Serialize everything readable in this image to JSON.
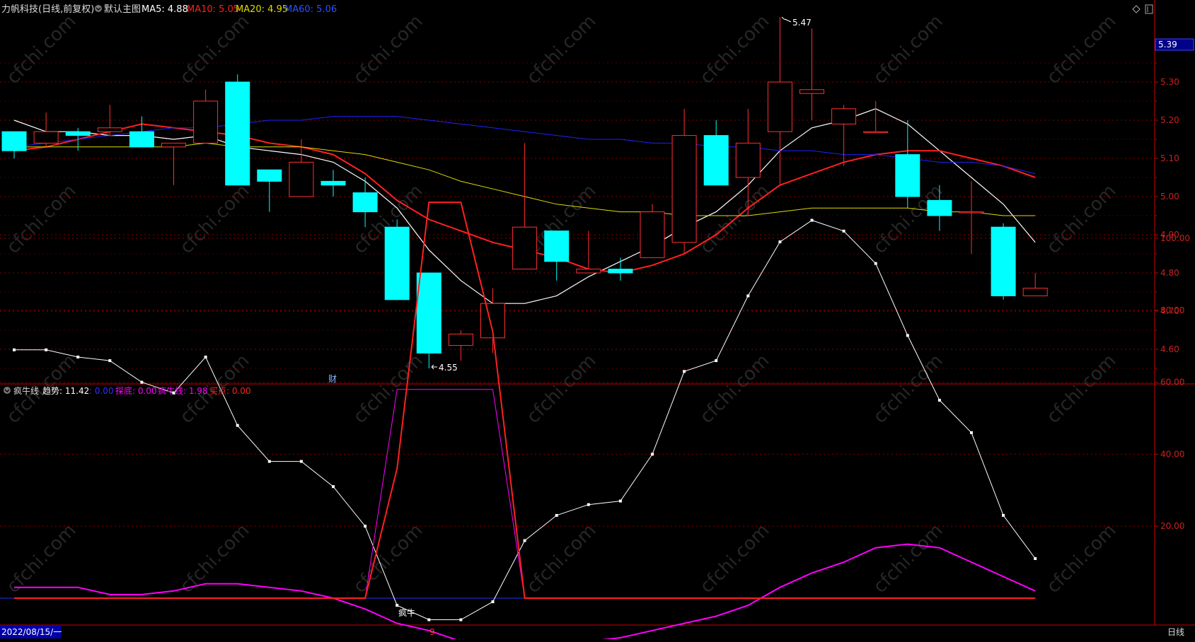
{
  "main_header": {
    "title": "力帆科技(日线,前复权)",
    "template": "默认主图",
    "ma5": "MA5: 4.88",
    "ma10": "MA10: 5.05",
    "ma20": "MA20: 4.95",
    "ma60": "MA60: 5.06"
  },
  "sub_header": {
    "name": "疯牛线",
    "trend": "趋势: 11.42",
    "blue": ": 0.00",
    "bottom": "探底: 0.00",
    "bull": "疯牛线: 1.98",
    "buy": "买点: 0.00"
  },
  "footer": {
    "date": "2022/08/15/一",
    "marker": "9",
    "period": "日线"
  },
  "labels": {
    "high": "5.47",
    "low": "4.55",
    "fin": "财",
    "bull_signal": "疯牛",
    "price_tag": "5.39"
  },
  "colors": {
    "up": "#ff3030",
    "down": "#00ffff",
    "ma5": "#ffffff",
    "ma10": "#ff2020",
    "ma20": "#dddd00",
    "ma60": "#2020ff",
    "magenta": "#ff00ff",
    "grid": "#8b0000",
    "axis": "#c80000"
  },
  "chart_data": [
    {
      "type": "candlestick",
      "title": "力帆科技(日线,前复权)",
      "ylim": [
        4.5,
        5.5
      ],
      "yticks": [
        "5.30",
        "5.20",
        "5.10",
        "5.00",
        "4.90",
        "4.80",
        "4.70",
        "4.60"
      ],
      "ohlc": [
        [
          5.17,
          5.17,
          5.1,
          5.12
        ],
        [
          5.14,
          5.22,
          5.13,
          5.17
        ],
        [
          5.17,
          5.18,
          5.12,
          5.16
        ],
        [
          5.17,
          5.24,
          5.16,
          5.18
        ],
        [
          5.17,
          5.21,
          5.13,
          5.13
        ],
        [
          5.13,
          5.14,
          5.03,
          5.14
        ],
        [
          5.14,
          5.28,
          5.14,
          5.25
        ],
        [
          5.3,
          5.32,
          5.03,
          5.03
        ],
        [
          5.07,
          5.07,
          4.96,
          5.04
        ],
        [
          5.0,
          5.15,
          5.0,
          5.09
        ],
        [
          5.04,
          5.07,
          5.0,
          5.03
        ],
        [
          5.01,
          5.05,
          4.92,
          4.96
        ],
        [
          4.92,
          4.94,
          4.73,
          4.73
        ],
        [
          4.8,
          4.8,
          4.55,
          4.59
        ],
        [
          4.61,
          4.65,
          4.57,
          4.64
        ],
        [
          4.63,
          4.76,
          4.59,
          4.72
        ],
        [
          4.81,
          5.14,
          4.81,
          4.92
        ],
        [
          4.91,
          4.91,
          4.78,
          4.83
        ],
        [
          4.8,
          4.91,
          4.8,
          4.81
        ],
        [
          4.81,
          4.84,
          4.78,
          4.8
        ],
        [
          4.84,
          4.98,
          4.84,
          4.96
        ],
        [
          4.88,
          5.23,
          4.85,
          5.16
        ],
        [
          5.16,
          5.2,
          5.03,
          5.03
        ],
        [
          5.05,
          5.23,
          4.95,
          5.14
        ],
        [
          5.17,
          5.47,
          5.03,
          5.3
        ],
        [
          5.27,
          5.44,
          5.2,
          5.28
        ],
        [
          5.19,
          5.24,
          5.08,
          5.23
        ],
        [
          5.17,
          5.25,
          5.17,
          5.17
        ],
        [
          5.11,
          5.2,
          4.97,
          5.0
        ],
        [
          4.99,
          5.03,
          4.91,
          4.95
        ],
        [
          4.96,
          5.04,
          4.85,
          4.96
        ],
        [
          4.92,
          4.93,
          4.73,
          4.74
        ],
        [
          4.74,
          4.8,
          4.74,
          4.76
        ]
      ],
      "series": [
        {
          "name": "MA5",
          "values": [
            5.2,
            5.17,
            5.17,
            5.16,
            5.16,
            5.15,
            5.16,
            5.13,
            5.12,
            5.11,
            5.09,
            5.04,
            4.97,
            4.86,
            4.78,
            4.72,
            4.72,
            4.74,
            4.79,
            4.83,
            4.87,
            4.92,
            4.96,
            5.03,
            5.12,
            5.18,
            5.2,
            5.23,
            5.19,
            5.12,
            5.05,
            4.98,
            4.88
          ]
        },
        {
          "name": "MA10",
          "values": [
            5.12,
            5.13,
            5.15,
            5.17,
            5.19,
            5.18,
            5.17,
            5.16,
            5.14,
            5.13,
            5.11,
            5.06,
            4.99,
            4.94,
            4.91,
            4.88,
            4.86,
            4.84,
            4.81,
            4.8,
            4.82,
            4.85,
            4.9,
            4.97,
            5.03,
            5.06,
            5.09,
            5.11,
            5.12,
            5.12,
            5.1,
            5.08,
            5.05
          ]
        },
        {
          "name": "MA20",
          "values": [
            5.13,
            5.13,
            5.13,
            5.13,
            5.13,
            5.13,
            5.14,
            5.13,
            5.13,
            5.13,
            5.12,
            5.11,
            5.09,
            5.07,
            5.04,
            5.02,
            5.0,
            4.98,
            4.97,
            4.96,
            4.96,
            4.95,
            4.95,
            4.95,
            4.96,
            4.97,
            4.97,
            4.97,
            4.97,
            4.96,
            4.96,
            4.95,
            4.95
          ]
        },
        {
          "name": "MA60",
          "values": [
            5.13,
            5.14,
            5.15,
            5.16,
            5.17,
            5.18,
            5.18,
            5.19,
            5.2,
            5.2,
            5.21,
            5.21,
            5.21,
            5.2,
            5.19,
            5.18,
            5.17,
            5.16,
            5.15,
            5.15,
            5.14,
            5.14,
            5.13,
            5.13,
            5.12,
            5.12,
            5.11,
            5.11,
            5.1,
            5.09,
            5.09,
            5.08,
            5.06
          ]
        }
      ]
    },
    {
      "type": "line",
      "title": "疯牛线",
      "ylim": [
        -10,
        122
      ],
      "yticks": [
        "100.00",
        "80.00",
        "60.00",
        "40.00",
        "20.00"
      ],
      "series": [
        {
          "name": "趋势",
          "values": [
            69,
            69,
            67,
            66,
            60,
            57,
            67,
            48,
            38,
            38,
            31,
            20,
            -2,
            -6,
            -6,
            -1,
            16,
            23,
            26,
            27,
            40,
            63,
            66,
            84,
            99,
            105,
            102,
            93,
            73,
            55,
            46,
            23,
            11
          ]
        },
        {
          "name": "疯牛线",
          "values": [
            3,
            3,
            3,
            1,
            1,
            2,
            4,
            4,
            3,
            2,
            0,
            -3,
            -7,
            -9,
            -12,
            -14,
            -14,
            -14,
            -12,
            -11,
            -9,
            -7,
            -5,
            -2,
            3,
            7,
            10,
            14,
            15,
            14,
            10,
            6,
            2
          ]
        },
        {
          "name": "探底",
          "values": [
            0,
            0,
            0,
            0,
            0,
            0,
            0,
            0,
            0,
            0,
            0,
            0,
            58,
            58,
            58,
            58,
            0,
            0,
            0,
            0,
            0,
            0,
            0,
            0,
            0,
            0,
            0,
            0,
            0,
            0,
            0,
            0,
            0
          ]
        },
        {
          "name": "买点",
          "values": [
            0,
            0,
            0,
            0,
            0,
            0,
            0,
            0,
            0,
            0,
            0,
            0,
            36,
            110,
            110,
            74,
            0,
            0,
            0,
            0,
            0,
            0,
            0,
            0,
            0,
            0,
            0,
            0,
            0,
            0,
            0,
            0,
            0
          ]
        }
      ]
    }
  ]
}
